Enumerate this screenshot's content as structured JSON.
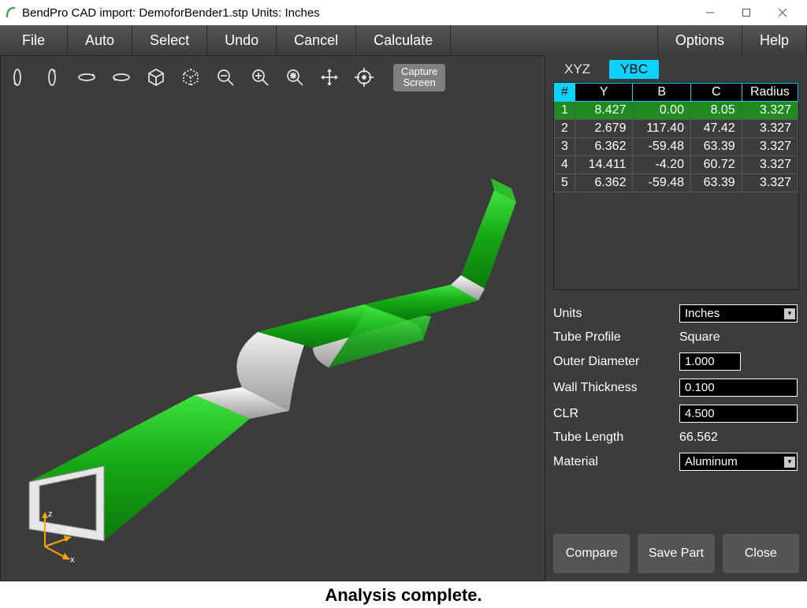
{
  "window": {
    "title": "BendPro CAD import: DemoforBender1.stp  Units: Inches"
  },
  "menubar": {
    "items": [
      "File",
      "Auto",
      "Select",
      "Undo",
      "Cancel",
      "Calculate"
    ],
    "right_items": [
      "Options",
      "Help"
    ]
  },
  "toolbar": {
    "capture_label_l1": "Capture",
    "capture_label_l2": "Screen"
  },
  "tabs": {
    "xyz": "XYZ",
    "ybc": "YBC",
    "active": "ybc"
  },
  "table": {
    "headers": [
      "#",
      "Y",
      "B",
      "C",
      "Radius"
    ],
    "rows": [
      {
        "n": "1",
        "y": "8.427",
        "b": "0.00",
        "c": "8.05",
        "r": "3.327"
      },
      {
        "n": "2",
        "y": "2.679",
        "b": "117.40",
        "c": "47.42",
        "r": "3.327"
      },
      {
        "n": "3",
        "y": "6.362",
        "b": "-59.48",
        "c": "63.39",
        "r": "3.327"
      },
      {
        "n": "4",
        "y": "14.411",
        "b": "-4.20",
        "c": "60.72",
        "r": "3.327"
      },
      {
        "n": "5",
        "y": "6.362",
        "b": "-59.48",
        "c": "63.39",
        "r": "3.327"
      }
    ],
    "selected_row": 0
  },
  "properties": {
    "units_label": "Units",
    "units_value": "Inches",
    "profile_label": "Tube Profile",
    "profile_value": "Square",
    "outer_diameter_label": "Outer Diameter",
    "outer_diameter_value": "1.000",
    "wall_thickness_label": "Wall Thickness",
    "wall_thickness_value": "0.100",
    "clr_label": "CLR",
    "clr_value": "4.500",
    "tube_length_label": "Tube Length",
    "tube_length_value": "66.562",
    "material_label": "Material",
    "material_value": "Aluminum"
  },
  "buttons": {
    "compare": "Compare",
    "save_part": "Save Part",
    "close": "Close"
  },
  "status": {
    "text": "Analysis complete."
  },
  "axis": {
    "x": "x",
    "y": "y",
    "z": "z"
  }
}
